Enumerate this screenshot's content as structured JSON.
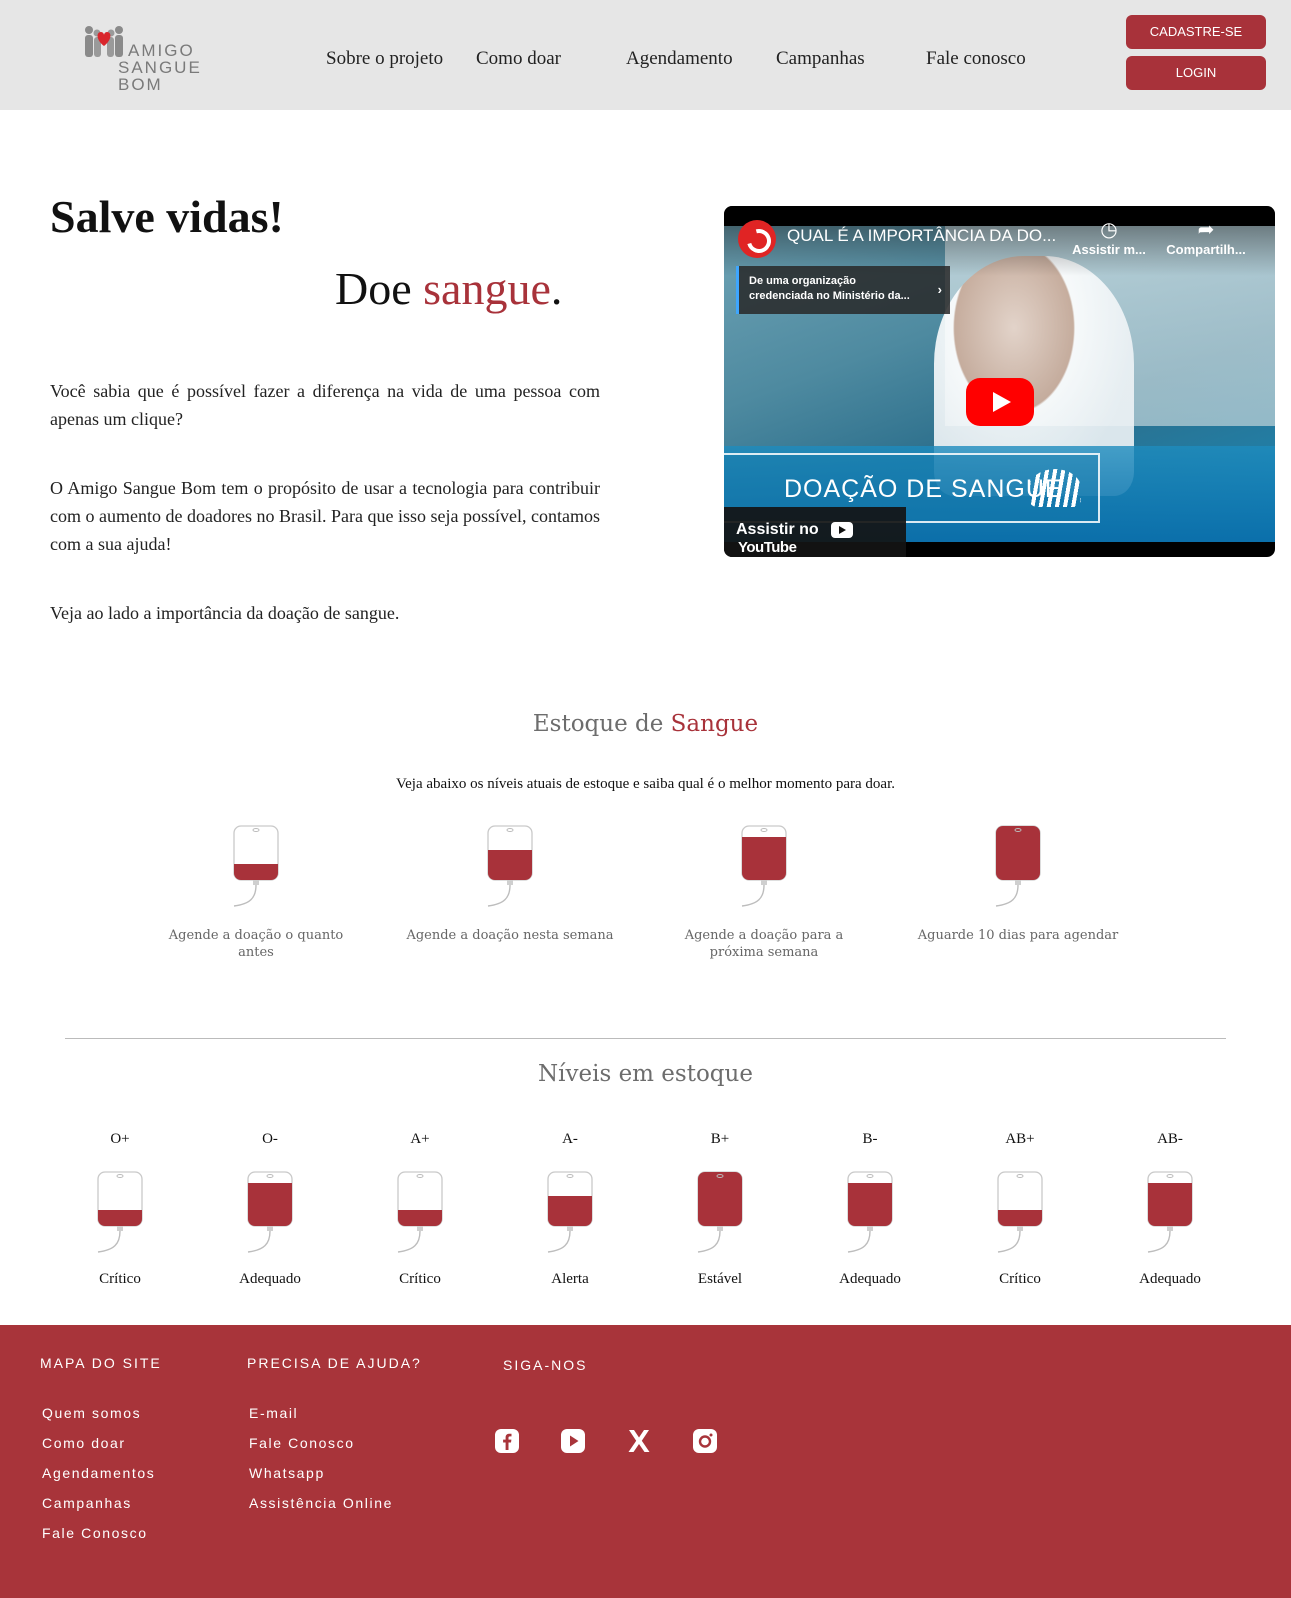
{
  "header": {
    "logo": {
      "line1": "AMIGO",
      "line2": "SANGUE",
      "line3": "BOM"
    },
    "nav": [
      {
        "label": "Sobre o projeto"
      },
      {
        "label": "Como doar"
      },
      {
        "label": "Agendamento"
      },
      {
        "label": "Campanhas"
      },
      {
        "label": "Fale conosco"
      }
    ],
    "signup_label": "CADASTRE-SE",
    "login_label": "LOGIN"
  },
  "hero": {
    "title": "Salve vidas!",
    "subtitle_prefix": "Doe ",
    "subtitle_accent": "sangue",
    "subtitle_suffix": ".",
    "paragraphs": [
      "Você sabia que é possível fazer a diferença na vida de uma pessoa com apenas um clique?",
      "O Amigo Sangue Bom tem o propósito de usar a tecnologia para contribuir com o aumento de doadores no Brasil. Para que isso seja possível, contamos com a sua ajuda!",
      "Veja ao lado a importância da doação de sangue."
    ]
  },
  "video": {
    "title": "QUAL É A IMPORTÂNCIA DA DO...",
    "watch_later": "Assistir m...",
    "share": "Compartilh...",
    "info_line1": "De uma organização",
    "info_line2": "credenciada no Ministério da...",
    "banner": "DOAÇÃO DE SANGUE",
    "watch_on": "Assistir no",
    "youtube": "YouTube"
  },
  "stock": {
    "title_prefix": "Estoque de ",
    "title_accent": "Sangue",
    "description": "Veja abaixo os níveis atuais de estoque e saiba qual é o melhor momento para doar.",
    "legend": [
      {
        "label": "Agende a doação o quanto antes",
        "fill": 0.3
      },
      {
        "label": "Agende a doação nesta semana",
        "fill": 0.55
      },
      {
        "label": "Agende a doação para a próxima semana",
        "fill": 0.8
      },
      {
        "label": "Aguarde 10 dias para agendar",
        "fill": 1.0
      }
    ]
  },
  "levels": {
    "title": "Níveis em estoque",
    "types": [
      {
        "type": "O+",
        "status": "Crítico",
        "fill": 0.3
      },
      {
        "type": "O-",
        "status": "Adequado",
        "fill": 0.8
      },
      {
        "type": "A+",
        "status": "Crítico",
        "fill": 0.3
      },
      {
        "type": "A-",
        "status": "Alerta",
        "fill": 0.55
      },
      {
        "type": "B+",
        "status": "Estável",
        "fill": 1.0
      },
      {
        "type": "B-",
        "status": "Adequado",
        "fill": 0.8
      },
      {
        "type": "AB+",
        "status": "Crítico",
        "fill": 0.3
      },
      {
        "type": "AB-",
        "status": "Adequado",
        "fill": 0.8
      }
    ]
  },
  "footer": {
    "sitemap_title": "MAPA DO SITE",
    "sitemap": [
      "Quem somos",
      "Como doar",
      "Agendamentos",
      "Campanhas",
      "Fale Conosco"
    ],
    "help_title": "PRECISA DE AJUDA?",
    "help": [
      "E-mail",
      "Fale Conosco",
      "Whatsapp",
      "Assistência Online"
    ],
    "social_title": "SIGA-NOS",
    "social_icons": [
      "facebook-icon",
      "youtube-icon",
      "x-icon",
      "instagram-icon"
    ]
  },
  "colors": {
    "accent": "#a8323a",
    "header_bg": "#e6e6e6",
    "footer_bg": "#a8343a"
  }
}
